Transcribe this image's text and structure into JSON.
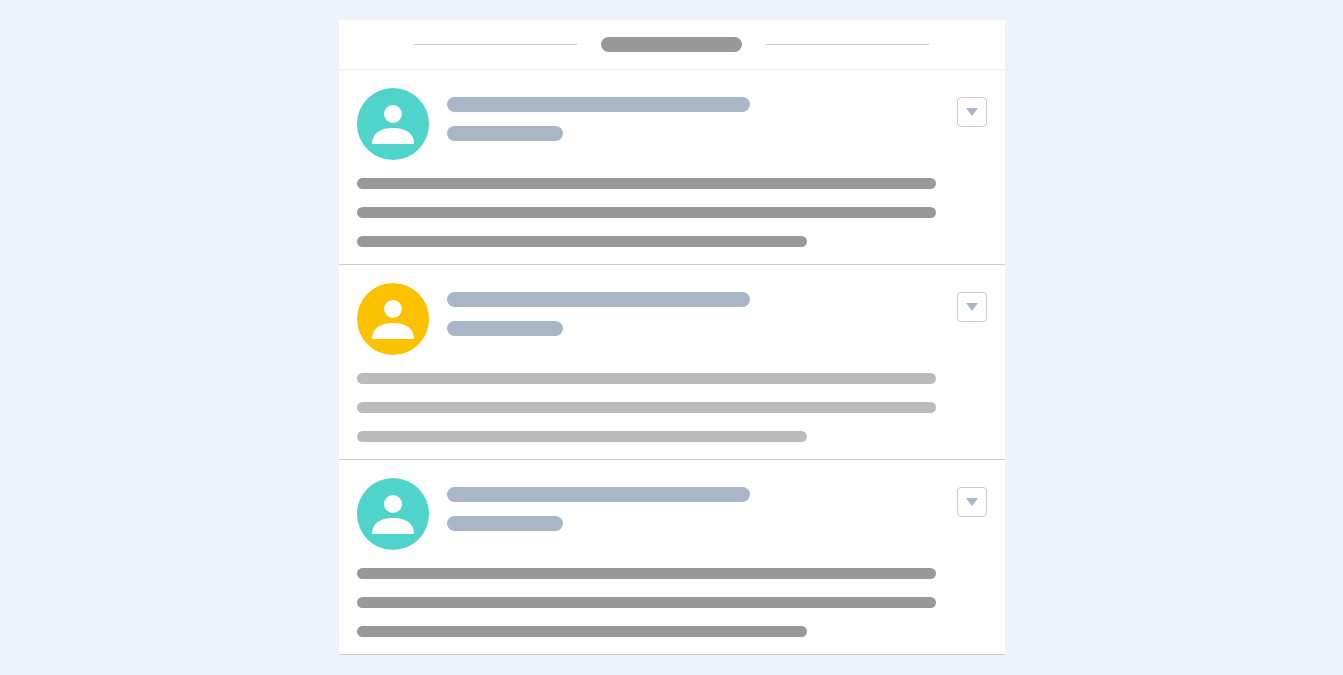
{
  "posts": [
    {
      "avatar": {
        "color": "#4fd4cc"
      },
      "muted": false
    },
    {
      "avatar": {
        "color": "#fcc200"
      },
      "muted": true
    },
    {
      "avatar": {
        "color": "#4fd4cc"
      },
      "muted": false
    }
  ]
}
